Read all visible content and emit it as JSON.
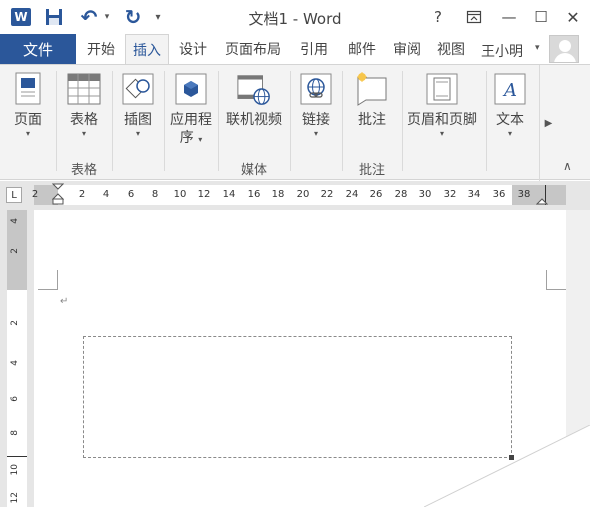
{
  "app": {
    "title": "文档1 - Word",
    "logo_letter": "W"
  },
  "qat": {
    "icons": [
      "word-logo-icon",
      "save-icon",
      "undo-icon",
      "redo-icon",
      "customize-qat-icon"
    ],
    "undo_glyph": "↶",
    "redo_glyph": "↻",
    "dropdown_glyph": "▾"
  },
  "window_controls": {
    "help": "?",
    "ribbon_options": "⊼",
    "minimize": "—",
    "maximize": "☐",
    "close": "✕"
  },
  "tabs": {
    "file": "文件",
    "items": [
      "开始",
      "插入",
      "设计",
      "页面布局",
      "引用",
      "邮件",
      "审阅",
      "视图"
    ],
    "active": "插入"
  },
  "user": {
    "name": "王小明",
    "dropdown": "▾"
  },
  "ribbon": {
    "buttons": {
      "pages": "页面",
      "table": "表格",
      "illustrations": "插图",
      "apps_line1": "应用程",
      "apps_line2": "序",
      "online_video": "联机视频",
      "links": "链接",
      "comment": "批注",
      "header_footer": "页眉和页脚",
      "text": "文本"
    },
    "group_labels": {
      "tables": "表格",
      "media": "媒体",
      "comments": "批注"
    },
    "dropdown_glyph": "▾",
    "scroll_glyph": "▶",
    "collapse_glyph": "∧"
  },
  "ruler": {
    "corner": "L",
    "h_ticks": [
      "2",
      "2",
      "4",
      "6",
      "8",
      "10",
      "12",
      "14",
      "16",
      "18",
      "20",
      "22",
      "24",
      "26",
      "28",
      "30",
      "32",
      "34",
      "36",
      "38"
    ],
    "v_ticks": [
      "4",
      "2",
      "2",
      "4",
      "6",
      "8",
      "10",
      "12"
    ]
  },
  "document": {
    "paragraph_mark": "↵"
  },
  "colors": {
    "accent": "#2b579a",
    "ribbon_bg": "#f3f3f3",
    "ruler_margin": "#c6c6c6",
    "canvas": "#e6e6e6"
  }
}
